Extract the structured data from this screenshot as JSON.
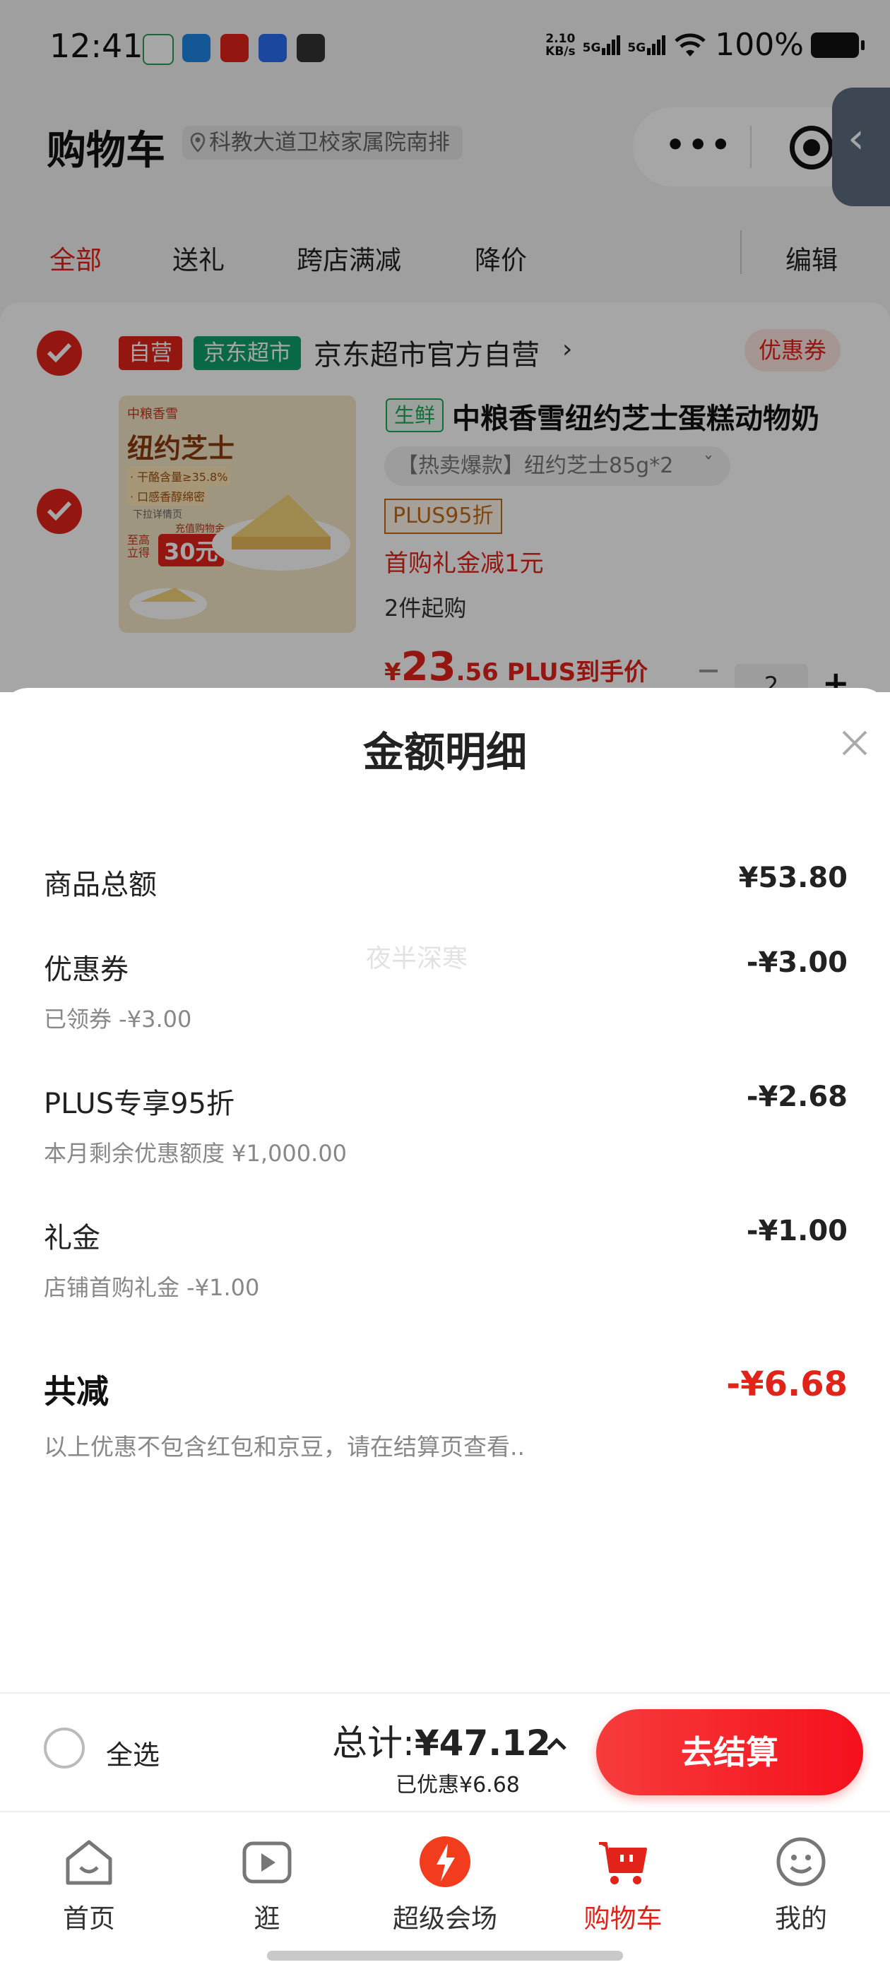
{
  "status_bar": {
    "time": "12:41",
    "network_speed_value": "2.10",
    "network_speed_unit": "KB/s",
    "signal1": "5G",
    "signal2": "5G",
    "battery": "100%",
    "app_icons": [
      "home-app-icon",
      "chat-app-icon",
      "red-app-icon",
      "blue-app-icon",
      "browser-app-icon"
    ]
  },
  "header": {
    "title": "购物车",
    "address": "科教大道卫校家属院南排",
    "capsule_more": "•••"
  },
  "tabs": [
    "全部",
    "送礼",
    "跨店满减",
    "降价"
  ],
  "tab_edit": "编辑",
  "shop": {
    "tag_self": "自营",
    "tag_market": "京东超市",
    "name": "京东超市官方自营",
    "coupon": "优惠券"
  },
  "product": {
    "fresh_tag": "生鲜",
    "title": "中粮香雪纽约芝士蛋糕动物奶",
    "variant": "【热卖爆款】纽约芝士85g*2",
    "plus_tag": "PLUS95折",
    "gift": "首购礼金减1元",
    "min_buy": "2件起购",
    "price_symbol": "¥",
    "price_int": "23",
    "price_dec": ".56",
    "price_note": "PLUS到手价",
    "qty": "2",
    "img_brand": "中粮香雪",
    "img_title": "纽约芝士",
    "img_line1": "· 干酪含量≥35.8%",
    "img_line2": "· 口感香醇绵密",
    "img_tip": "下拉详情页",
    "img_tip2": "充值购物金",
    "img_deal": "至高立得",
    "img_amount": "30元"
  },
  "modal": {
    "title": "金额明细",
    "watermark": "夜半深寒",
    "rows": [
      {
        "label": "商品总额",
        "value": "¥53.80",
        "sub": ""
      },
      {
        "label": "优惠券",
        "value": "-¥3.00",
        "sub": "已领券 -¥3.00"
      },
      {
        "label": "PLUS专享95折",
        "value": "-¥2.68",
        "sub": "本月剩余优惠额度 ¥1,000.00"
      },
      {
        "label": "礼金",
        "value": "-¥1.00",
        "sub": "店铺首购礼金 -¥1.00"
      }
    ],
    "total_label": "共减",
    "total_value": "-¥6.68",
    "note": "以上优惠不包含红包和京豆，请在结算页查看.."
  },
  "checkout": {
    "select_all": "全选",
    "total_prefix": "总计:",
    "total_amount": "¥47.12",
    "saved": "已优惠¥6.68",
    "button": "去结算"
  },
  "nav": [
    {
      "label": "首页",
      "icon": "home-icon"
    },
    {
      "label": "逛",
      "icon": "video-icon"
    },
    {
      "label": "超级会场",
      "icon": "super-venue-icon"
    },
    {
      "label": "购物车",
      "icon": "cart-icon"
    },
    {
      "label": "我的",
      "icon": "profile-icon"
    }
  ],
  "colors": {
    "accent": "#e2231a",
    "fresh_green": "#1fa95a",
    "market_green": "#0ea06b",
    "plus_orange": "#c06a1a"
  }
}
